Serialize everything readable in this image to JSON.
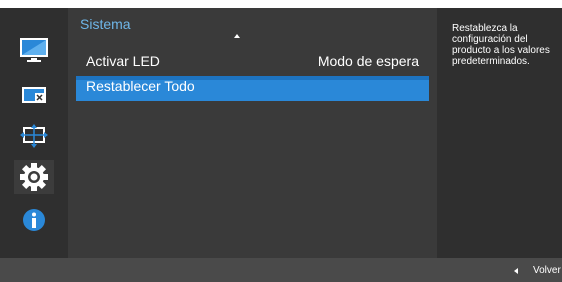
{
  "sidebar": {
    "items": [
      {
        "icon": "picture-icon"
      },
      {
        "icon": "screen-size-icon"
      },
      {
        "icon": "position-icon"
      },
      {
        "icon": "settings-gear-icon"
      },
      {
        "icon": "information-icon"
      }
    ],
    "active_index": 3
  },
  "menu": {
    "title": "Sistema",
    "items": [
      {
        "label": "Activar LED",
        "value": "Modo de espera"
      },
      {
        "label": "Restablecer Todo",
        "value": ""
      }
    ],
    "selected_index": 1
  },
  "description": {
    "text": "Restablezca la configuración del producto a los valores predeterminados."
  },
  "footer": {
    "back_label": "Volver"
  },
  "colors": {
    "accent": "#2a88d8",
    "title": "#6fb6e8",
    "panel": "#3a3a3a",
    "sidebar": "#2f2f2f",
    "frame": "#4a4a4a"
  }
}
